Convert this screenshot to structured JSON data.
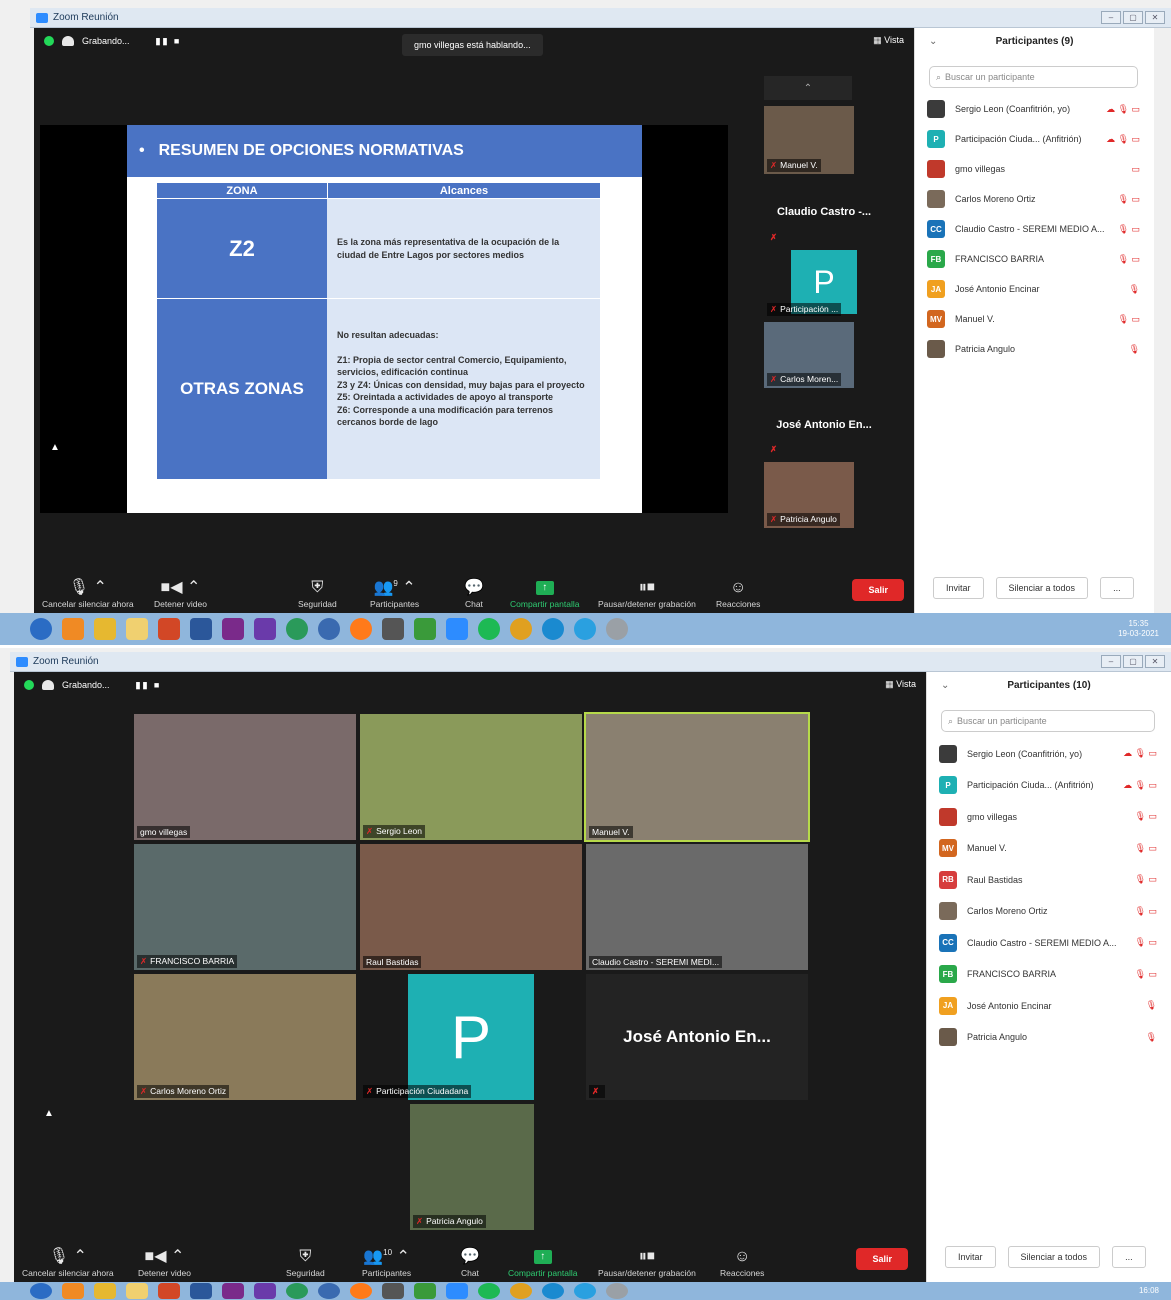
{
  "window": {
    "title": "Zoom Reunión",
    "controls": [
      "–",
      "▢",
      "✕"
    ]
  },
  "top_bar": {
    "recording_label": "Grabando...",
    "pause_stop": "▮▮ ■",
    "view_label": "Vista"
  },
  "toolbar": {
    "mute": "Cancelar silenciar ahora",
    "video": "Detener video",
    "security": "Seguridad",
    "participants": "Participantes",
    "chat": "Chat",
    "share": "Compartir pantalla",
    "record": "Pausar/detener grabación",
    "reactions": "Reacciones",
    "leave": "Salir"
  },
  "panel": {
    "search_placeholder": "Buscar un participante",
    "invite": "Invitar",
    "mute_all": "Silenciar a todos",
    "more": "..."
  },
  "shot1": {
    "speaking_banner": "gmo villegas está hablando...",
    "participant_count_badge": "9",
    "panel_title": "Participantes (9)",
    "participants": [
      {
        "initials": "",
        "name": "Sergio Leon (Coanfitrión, yo)",
        "color": "#3b3b3b",
        "icons": "☁ 🎙 ▭"
      },
      {
        "initials": "P",
        "name": "Participación Ciuda... (Anfitrión)",
        "color": "#1eb0b3",
        "icons": "☁ 🎙 ▭"
      },
      {
        "initials": "",
        "name": "gmo villegas",
        "color": "#c0392b",
        "icons": "▭"
      },
      {
        "initials": "",
        "name": "Carlos Moreno Ortiz",
        "color": "#7a6a5a",
        "icons": "🎙 ▭"
      },
      {
        "initials": "CC",
        "name": "Claudio Castro - SEREMI MEDIO A...",
        "color": "#1a73b8",
        "icons": "🎙 ▭"
      },
      {
        "initials": "FB",
        "name": "FRANCISCO BARRIA",
        "color": "#2aa84a",
        "icons": "🎙 ▭"
      },
      {
        "initials": "JA",
        "name": "José Antonio Encinar",
        "color": "#f0a020",
        "icons": "🎙"
      },
      {
        "initials": "MV",
        "name": "Manuel V.",
        "color": "#d2661f",
        "icons": "🎙 ▭"
      },
      {
        "initials": "",
        "name": "Patricia Angulo",
        "color": "#6a5a4a",
        "icons": "🎙"
      }
    ],
    "strip": [
      {
        "type": "video",
        "label": "Manuel V.",
        "color": "#6b5a4a"
      },
      {
        "type": "name",
        "label": "Claudio Castro -..."
      },
      {
        "type": "letter",
        "letter": "P",
        "label": "Participación ..."
      },
      {
        "type": "video",
        "label": "Carlos Moren...",
        "color": "#5a6a7a"
      },
      {
        "type": "name",
        "label": "José Antonio En..."
      },
      {
        "type": "video",
        "label": "Patricia Angulo",
        "color": "#7a5a4a"
      }
    ],
    "slide": {
      "bullet": "•",
      "title": "RESUMEN DE OPCIONES NORMATIVAS",
      "header_zona": "ZONA",
      "header_alcances": "Alcances",
      "rows": [
        {
          "zona": "Z2",
          "text": "Es la zona más representativa de la ocupación de la ciudad de Entre Lagos por sectores medios"
        },
        {
          "zona": "OTRAS ZONAS",
          "lines": [
            "No resultan adecuadas:",
            "",
            "Z1: Propia de sector central Comercio, Equipamiento, servicios, edificación continua",
            "Z3 y Z4: Únicas con densidad, muy bajas para el proyecto",
            "Z5: Oreintada a actividades de apoyo al transporte",
            "Z6: Corresponde a una modificación para terrenos cercanos borde de lago"
          ]
        }
      ]
    },
    "clock": {
      "time": "15:35",
      "date": "19-03-2021"
    }
  },
  "shot2": {
    "participant_count_badge": "10",
    "panel_title": "Participantes (10)",
    "participants": [
      {
        "initials": "",
        "name": "Sergio Leon (Coanfitrión, yo)",
        "color": "#3b3b3b",
        "icons": "☁ 🎙 ▭"
      },
      {
        "initials": "P",
        "name": "Participación Ciuda... (Anfitrión)",
        "color": "#1eb0b3",
        "icons": "☁ 🎙 ▭"
      },
      {
        "initials": "",
        "name": "gmo villegas",
        "color": "#c0392b",
        "icons": "🎙 ▭"
      },
      {
        "initials": "MV",
        "name": "Manuel V.",
        "color": "#d2661f",
        "icons": "🎙 ▭"
      },
      {
        "initials": "RB",
        "name": "Raul Bastidas",
        "color": "#d63d3d",
        "icons": "🎙 ▭"
      },
      {
        "initials": "",
        "name": "Carlos Moreno Ortiz",
        "color": "#7a6a5a",
        "icons": "🎙 ▭"
      },
      {
        "initials": "CC",
        "name": "Claudio Castro - SEREMI MEDIO A...",
        "color": "#1a73b8",
        "icons": "🎙 ▭"
      },
      {
        "initials": "FB",
        "name": "FRANCISCO BARRIA",
        "color": "#2aa84a",
        "icons": "🎙 ▭"
      },
      {
        "initials": "JA",
        "name": "José Antonio Encinar",
        "color": "#f0a020",
        "icons": "🎙"
      },
      {
        "initials": "",
        "name": "Patricia Angulo",
        "color": "#6a5a4a",
        "icons": "🎙"
      }
    ],
    "gallery": [
      {
        "label": "gmo villegas",
        "muted": false,
        "color": "#7a6a6a"
      },
      {
        "label": "Sergio Leon",
        "muted": true,
        "color": "#8a9a5a"
      },
      {
        "label": "Manuel V.",
        "muted": false,
        "color": "#8a8070"
      },
      {
        "label": "FRANCISCO BARRIA",
        "muted": true,
        "color": "#5a6a6a"
      },
      {
        "label": "Raul Bastidas",
        "muted": false,
        "color": "#7a5a4a"
      },
      {
        "label": "Claudio Castro - SEREMI MEDI...",
        "muted": false,
        "color": "#6a6a6a"
      },
      {
        "label": "Carlos Moreno Ortiz",
        "muted": true,
        "color": "#8a7a5a"
      },
      {
        "label": "Participación Ciudadana",
        "muted": true,
        "letter": "P"
      },
      {
        "label": "",
        "muted": true,
        "name_card": "José Antonio En..."
      },
      {
        "label": "Patricia Angulo",
        "muted": true,
        "color": "#5a6a4a"
      }
    ],
    "clock": {
      "time": "16:08",
      "date": ""
    }
  }
}
